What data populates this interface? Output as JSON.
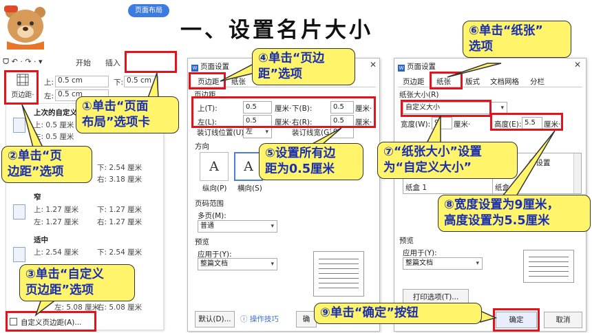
{
  "slide_title": "一、设置名片大小",
  "ribbon": {
    "undo_redo": "ᗜ ↶ · ↷ · ▾",
    "tabs": [
      "开始",
      "插入",
      "页面布局"
    ],
    "margin_button_label": "页边距·",
    "top_label": "上:",
    "top_value": "0.5 cm",
    "bottom_label": "下:",
    "bottom_value": "0.5 cm",
    "left_label": "左:",
    "left_value": "0.5 cm"
  },
  "margin_menu": {
    "last_custom": "上次的自定义",
    "last_top": "上: 0.5 厘米",
    "last_left": "左: 0.5 厘米",
    "normal_bottom": "下: 2.54 厘米",
    "normal_right": "右: 3.18 厘米",
    "narrow_name": "窄",
    "narrow_top": "上: 1.27 厘米",
    "narrow_bottom": "下: 1.27 厘米",
    "narrow_left": "左: 1.27 厘米",
    "narrow_right": "右: 1.27 厘米",
    "moderate_name": "适中",
    "moderate_top": "上: 2.54 厘米",
    "moderate_bottom": "下: 2.54 厘米",
    "wide_left": "左: 5.08 厘米",
    "wide_right": "右: 5.08 厘米",
    "custom_item": "自定义页边距(A)..."
  },
  "dialog1": {
    "title": "页面设置",
    "tabs": [
      "页边距",
      "纸张"
    ],
    "margins_section": "页边距",
    "top_label": "上(T):",
    "top_value": "0.5",
    "bottom_label": "下(B):",
    "bottom_value": "0.5",
    "left_label": "左(L):",
    "left_value": "0.5",
    "right_label": "右(R):",
    "right_value": "0.5",
    "unit": "厘米·",
    "gutter_pos_label": "装订线位置(U):",
    "gutter_pos_value": "左",
    "gutter_width_label": "装订线宽(G):",
    "gutter_width_value": "0",
    "orientation_section": "方向",
    "portrait": "纵向(P)",
    "landscape": "横向(S)",
    "page_range_section": "页码范围",
    "multi_pages_label": "多页(M):",
    "multi_pages_value": "普通",
    "preview_section": "预览",
    "apply_to_label": "应用于(Y):",
    "apply_to_value": "整篇文档",
    "default_button": "默认(D)...",
    "tips_link": "操作技巧",
    "ok_button": "确"
  },
  "dialog2": {
    "title": "页面设置",
    "tabs": [
      "页边距",
      "纸张",
      "版式",
      "文档网格",
      "分栏"
    ],
    "paper_size_section": "纸张大小(R)",
    "paper_size_value": "自定义大小",
    "width_label": "宽度(W):",
    "width_value": "9",
    "height_label": "高度(E):",
    "height_value": "5.5",
    "unit": "厘米·",
    "first_page_value": "纸盒 1",
    "other_pages_value": "纸盒 1",
    "settings_fragment": "ⓘ设置",
    "preview_section": "预览",
    "apply_to_label": "应用于(Y):",
    "apply_to_value": "整篇文档",
    "print_options_button": "打印选项(T)...",
    "ok_button": "确定",
    "cancel_button": "取消"
  },
  "callouts": {
    "c1": "①单击“页面\n布局”选项卡",
    "c2": "②单击“页\n边距”选项",
    "c3": "③单击“自定义\n页边距”选项",
    "c4": "④单击“页边\n距”选项",
    "c5": "⑤设置所有边\n距为0.5厘米",
    "c6": "⑥单击“纸张”\n选项",
    "c7": "⑦“纸张大小”设置\n为“自定义大小”",
    "c8": "⑧宽度设置为9厘米，\n高度设置为5.5厘米",
    "c9": "⑨单击“确定”按钮"
  },
  "colors": {
    "highlight": "#e4121b",
    "callout_bg": "#fff46a",
    "callout_text": "#1a2eb0",
    "accent_blue": "#3d7be0"
  }
}
